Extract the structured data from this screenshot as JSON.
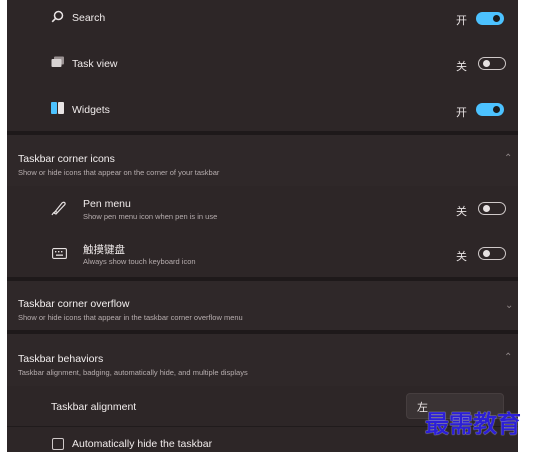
{
  "taskbar_items": {
    "search": {
      "label": "Search",
      "state": "开",
      "on": true
    },
    "task_view": {
      "label": "Task view",
      "state": "关",
      "on": false
    },
    "widgets": {
      "label": "Widgets",
      "state": "开",
      "on": true
    }
  },
  "corner_icons": {
    "title": "Taskbar corner icons",
    "subtitle": "Show or hide icons that appear on the corner of your taskbar",
    "pen_menu": {
      "label": "Pen menu",
      "description": "Show pen menu icon when pen is in use",
      "state": "关",
      "on": false
    },
    "touch_keyboard": {
      "label": "触摸键盘",
      "description": "Always show touch keyboard icon",
      "state": "关",
      "on": false
    }
  },
  "corner_overflow": {
    "title": "Taskbar corner overflow",
    "subtitle": "Show or hide icons that appear in the taskbar corner overflow menu"
  },
  "behaviors": {
    "title": "Taskbar behaviors",
    "subtitle": "Taskbar alignment, badging, automatically hide, and multiple displays",
    "alignment": {
      "label": "Taskbar alignment",
      "value": "左"
    },
    "autohide": {
      "label": "Automatically hide the taskbar",
      "checked": false
    }
  },
  "watermark": "最需教育",
  "colors": {
    "toggle_on": "#4cc2ff",
    "panel_bg": "#2e2728",
    "watermark": "#2c1fd6"
  },
  "icons": [
    "search-icon",
    "task-view-icon",
    "widgets-icon",
    "pen-icon",
    "keyboard-icon",
    "chevron-icon"
  ]
}
